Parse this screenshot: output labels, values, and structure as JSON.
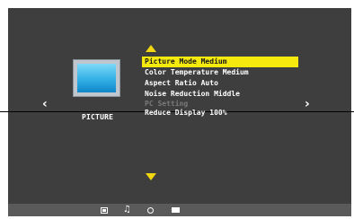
{
  "menu": {
    "category_label": "PICTURE",
    "items": [
      {
        "text": "Picture Mode  Medium",
        "state": "selected"
      },
      {
        "text": "Color Temperature Medium",
        "state": "normal"
      },
      {
        "text": "Aspect Ratio Auto",
        "state": "normal"
      },
      {
        "text": "Noise Reduction Middle",
        "state": "normal"
      },
      {
        "text": "PC Setting",
        "state": "disabled"
      },
      {
        "text": "Reduce Display 100%",
        "state": "normal"
      }
    ],
    "nav_left": "‹",
    "nav_right": "›"
  },
  "bottom_bar": {
    "icons": [
      "picture-icon",
      "sound-icon",
      "channel-icon",
      "screen-icon"
    ],
    "sound_glyph": "♫"
  },
  "colors": {
    "background": "#3e3e3e",
    "highlight": "#f5e90d",
    "arrow": "#f1d610",
    "bar": "#5a5a5a"
  }
}
